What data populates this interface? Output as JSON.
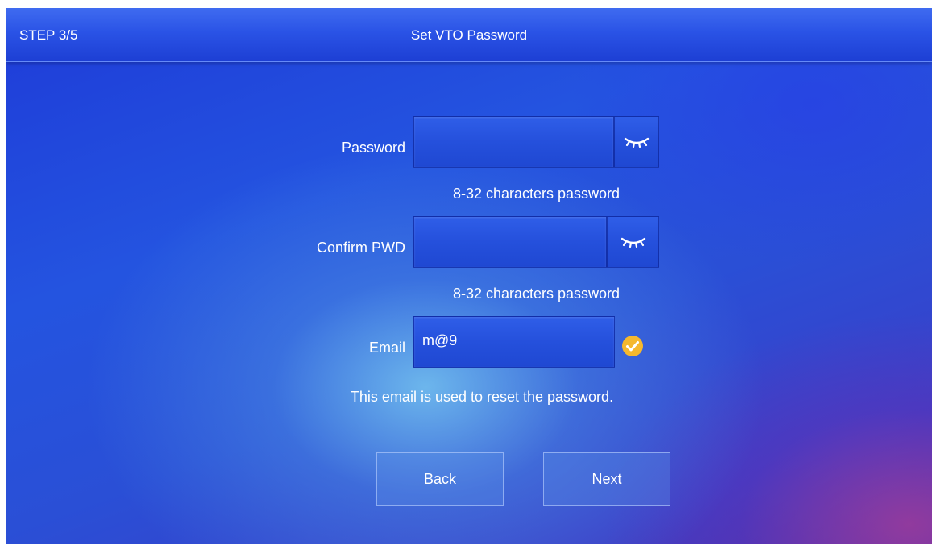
{
  "header": {
    "step": "STEP 3/5",
    "title": "Set VTO Password"
  },
  "form": {
    "password": {
      "label": "Password",
      "value": "",
      "hint": "8-32 characters password",
      "toggle_icon": "eye-closed-icon"
    },
    "confirm": {
      "label": "Confirm PWD",
      "value": "",
      "hint": "8-32 characters password",
      "toggle_icon": "eye-closed-icon"
    },
    "email": {
      "label": "Email",
      "value": "m@9",
      "hint": "This email is used to reset the password.",
      "status_icon": "check-circle-icon",
      "status_color": "#f5b82e"
    }
  },
  "buttons": {
    "back": "Back",
    "next": "Next"
  },
  "colors": {
    "accent": "#2550dc",
    "text": "#ffffff"
  }
}
